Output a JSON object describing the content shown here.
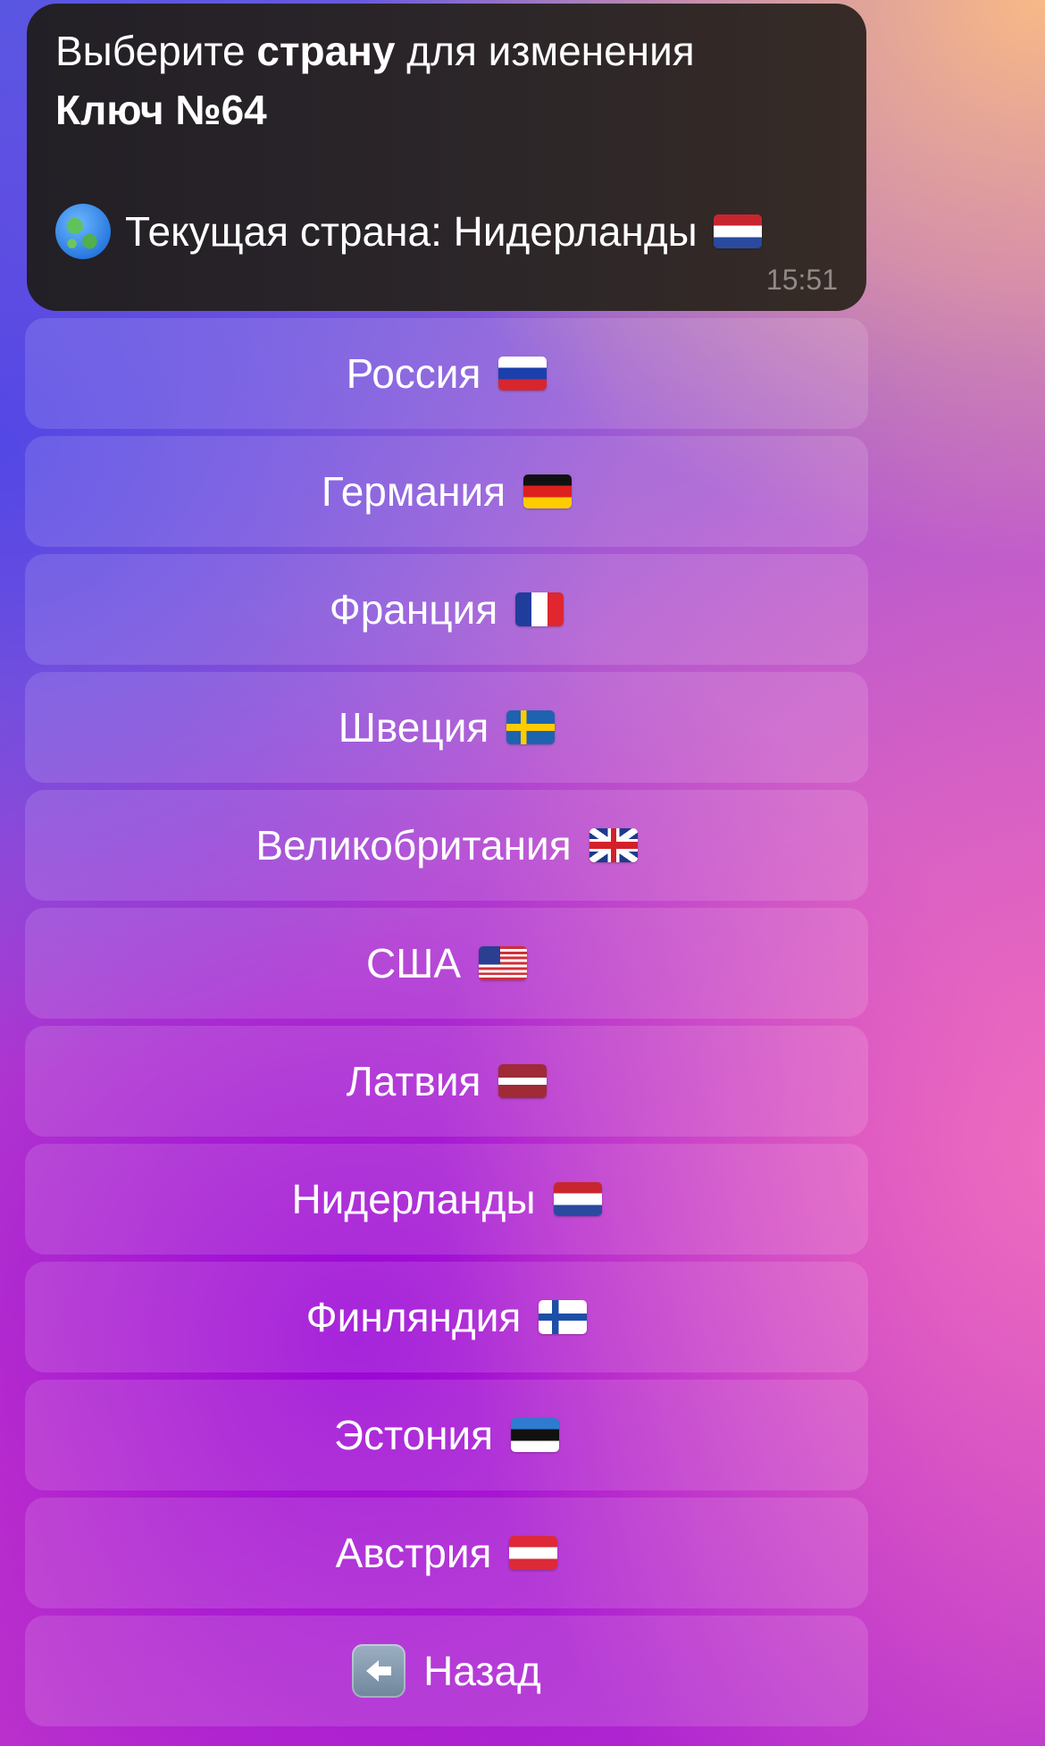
{
  "message": {
    "line1_prefix": "Выберите ",
    "line1_bold": "страну",
    "line1_suffix": " для изменения",
    "key_label": "Ключ №64",
    "current_country_text": "Текущая страна: Нидерланды",
    "current_country_icon": "globe-americas-icon",
    "current_country_flag": "netherlands-flag",
    "time": "15:51"
  },
  "buttons": [
    {
      "label": "Россия",
      "flag": "russia-flag"
    },
    {
      "label": "Германия",
      "flag": "germany-flag"
    },
    {
      "label": "Франция",
      "flag": "france-flag"
    },
    {
      "label": "Швеция",
      "flag": "sweden-flag"
    },
    {
      "label": "Великобритания",
      "flag": "united-kingdom-flag"
    },
    {
      "label": "США",
      "flag": "usa-flag"
    },
    {
      "label": "Латвия",
      "flag": "latvia-flag"
    },
    {
      "label": "Нидерланды",
      "flag": "netherlands-flag"
    },
    {
      "label": "Финляндия",
      "flag": "finland-flag"
    },
    {
      "label": "Эстония",
      "flag": "estonia-flag"
    },
    {
      "label": "Австрия",
      "flag": "austria-flag"
    }
  ],
  "back": {
    "label": "Назад",
    "icon": "back-arrow-icon"
  }
}
